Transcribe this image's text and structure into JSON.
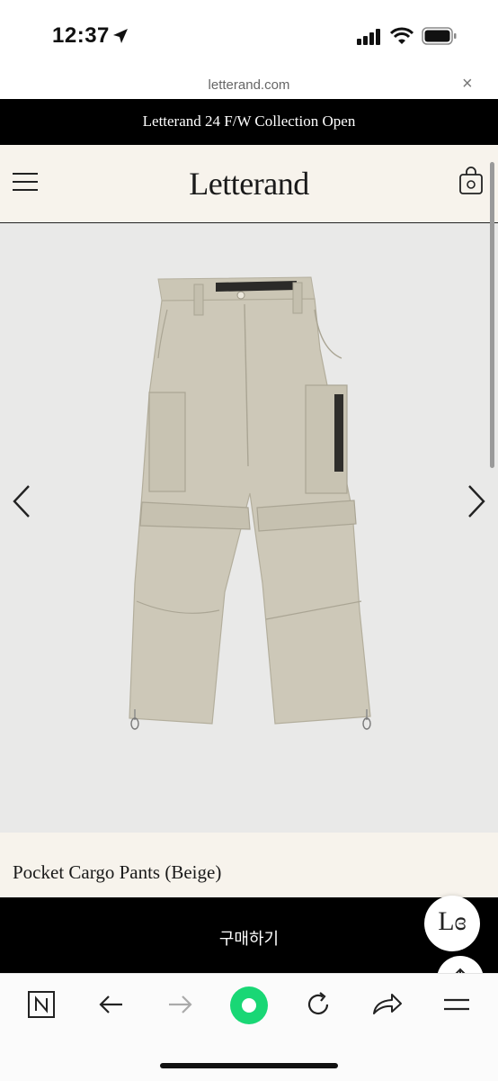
{
  "status_bar": {
    "time": "12:37"
  },
  "browser": {
    "url": "letterand.com",
    "close_symbol": "×"
  },
  "announcement": {
    "text": "Letterand 24 F/W Collection Open"
  },
  "header": {
    "logo": "Letterand"
  },
  "product": {
    "title": "Pocket Cargo Pants (Beige)",
    "buy_label": "구매하기"
  },
  "chat": {
    "badge_text": "Lɞ"
  },
  "colors": {
    "accent_green": "#19d775",
    "header_bg": "#f7f3ec",
    "product_color": "#cdc8b8"
  }
}
